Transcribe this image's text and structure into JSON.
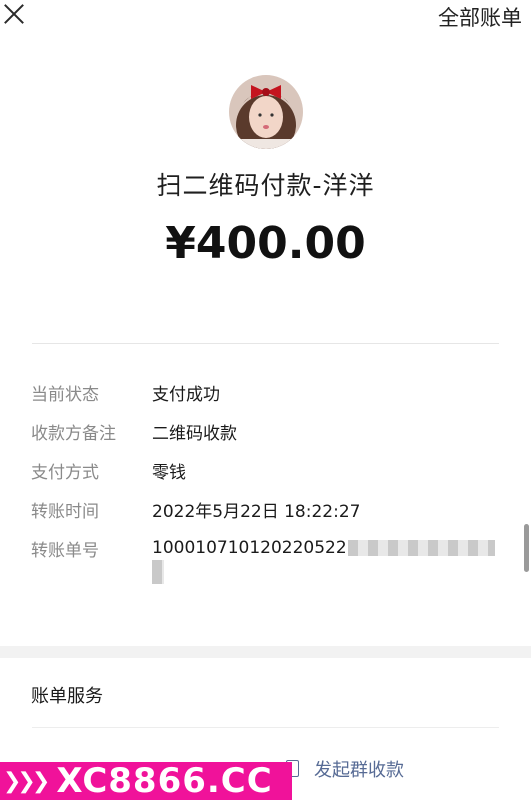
{
  "header": {
    "all_bills_label": "全部账单"
  },
  "payment": {
    "payee_title": "扫二维码付款-洋洋",
    "amount": "¥400.00"
  },
  "details": [
    {
      "label": "当前状态",
      "value": "支付成功"
    },
    {
      "label": "收款方备注",
      "value": "二维码收款"
    },
    {
      "label": "支付方式",
      "value": "零钱"
    },
    {
      "label": "转账时间",
      "value": "2022年5月22日 18:22:27"
    },
    {
      "label": "转账单号",
      "value": "100010710120220522"
    }
  ],
  "services": {
    "title": "账单服务",
    "group_collect_label": "发起群收款"
  },
  "watermark": {
    "text": "XC8866.CC"
  },
  "colors": {
    "link": "#576b95",
    "watermark_bg": "#f0129a"
  }
}
